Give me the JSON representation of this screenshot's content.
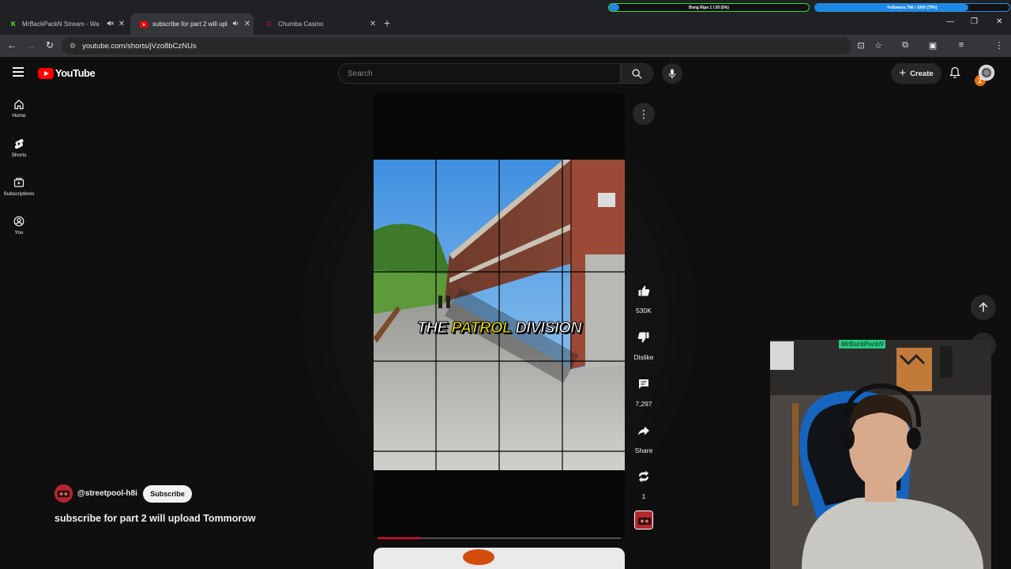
{
  "browser": {
    "tabs": [
      {
        "title": "MrBackPackN Stream - Wa",
        "favicon": "kick-icon",
        "color": "#53fc18",
        "active": false,
        "muted": true
      },
      {
        "title": "subscribe for part 2 will upl",
        "favicon": "youtube-icon",
        "color": "#ff0000",
        "active": true,
        "audio": true
      },
      {
        "title": "Chumba Casino",
        "favicon": "chumba-icon",
        "color": "#c8102e",
        "active": false
      }
    ],
    "url": "youtube.com/shorts/jVzo8bCzNUs"
  },
  "stream_goals": [
    {
      "text": "Bong Rips 1 / 20 (5%)",
      "progress": 0.05,
      "color": "#1e88e5",
      "border": "#3ad33a"
    },
    {
      "text": "Followers 786 / 1000 (79%)",
      "progress": 0.79,
      "color": "#1e88e5",
      "border": "#2a8fe0"
    }
  ],
  "header": {
    "logo_text": "YouTube",
    "search_placeholder": "Search",
    "create_label": "Create"
  },
  "sidebar": [
    {
      "label": "Home",
      "icon": "home-icon"
    },
    {
      "label": "Shorts",
      "icon": "shorts-icon"
    },
    {
      "label": "Subscriptions",
      "icon": "subscriptions-icon"
    },
    {
      "label": "You",
      "icon": "you-icon"
    }
  ],
  "short": {
    "caption_white_1": "THE",
    "caption_yellow": "PATROL",
    "caption_white_2": "DIVISION",
    "progress": 0.18,
    "channel_handle": "@streetpool-h8i",
    "subscribe_label": "Subscribe",
    "title": "subscribe for part 2 will upload Tommorow"
  },
  "actions": {
    "like_count": "530K",
    "dislike_label": "Dislike",
    "comments_count": "7,297",
    "share_label": "Share",
    "remix_count": "1"
  },
  "overlay": {
    "name_label": "MrBackPackN"
  },
  "colors": {
    "background": "#0f0f0f",
    "brand_red": "#ff0000",
    "caption_yellow": "#f5e400"
  }
}
